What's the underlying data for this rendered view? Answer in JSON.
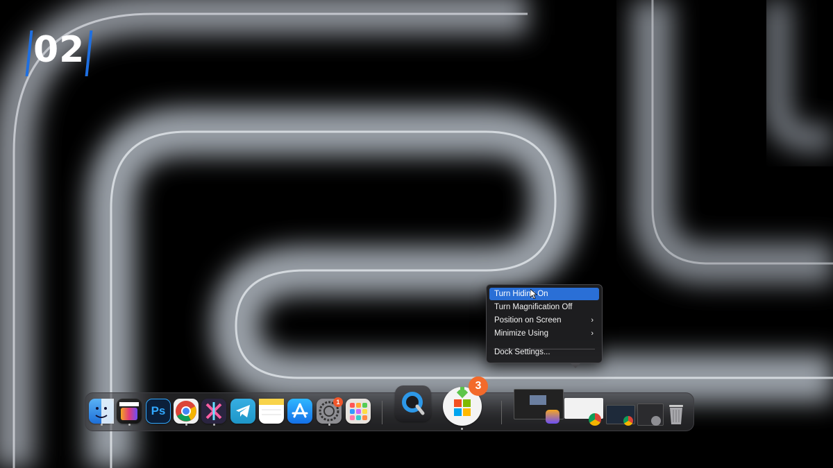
{
  "step_label": "02",
  "dock_menu": {
    "items": [
      {
        "label": "Turn Hiding On",
        "has_submenu": false,
        "highlighted": true
      },
      {
        "label": "Turn Magnification Off",
        "has_submenu": false,
        "highlighted": false
      },
      {
        "label": "Position on Screen",
        "has_submenu": true,
        "highlighted": false
      },
      {
        "label": "Minimize Using",
        "has_submenu": true,
        "highlighted": false
      }
    ],
    "settings_label": "Dock Settings...",
    "chevron": "›"
  },
  "dock": {
    "apps": [
      {
        "name": "finder-icon"
      },
      {
        "name": "final-cut-pro-icon"
      },
      {
        "name": "photoshop-icon",
        "text": "Ps"
      },
      {
        "name": "chrome-icon"
      },
      {
        "name": "xcode-like-icon"
      },
      {
        "name": "telegram-icon"
      },
      {
        "name": "notes-icon"
      },
      {
        "name": "app-store-icon"
      },
      {
        "name": "system-settings-icon",
        "badge": "1"
      },
      {
        "name": "launchpad-icon"
      }
    ],
    "recent": [
      {
        "name": "quicktime-icon"
      },
      {
        "name": "microsoft-store-installer-icon",
        "badge": "3"
      }
    ],
    "trash": {
      "name": "trash-icon"
    }
  },
  "colors": {
    "highlight": "#2a6fd6",
    "badge": "#f36a2b",
    "accent": "#1f6fe0"
  }
}
